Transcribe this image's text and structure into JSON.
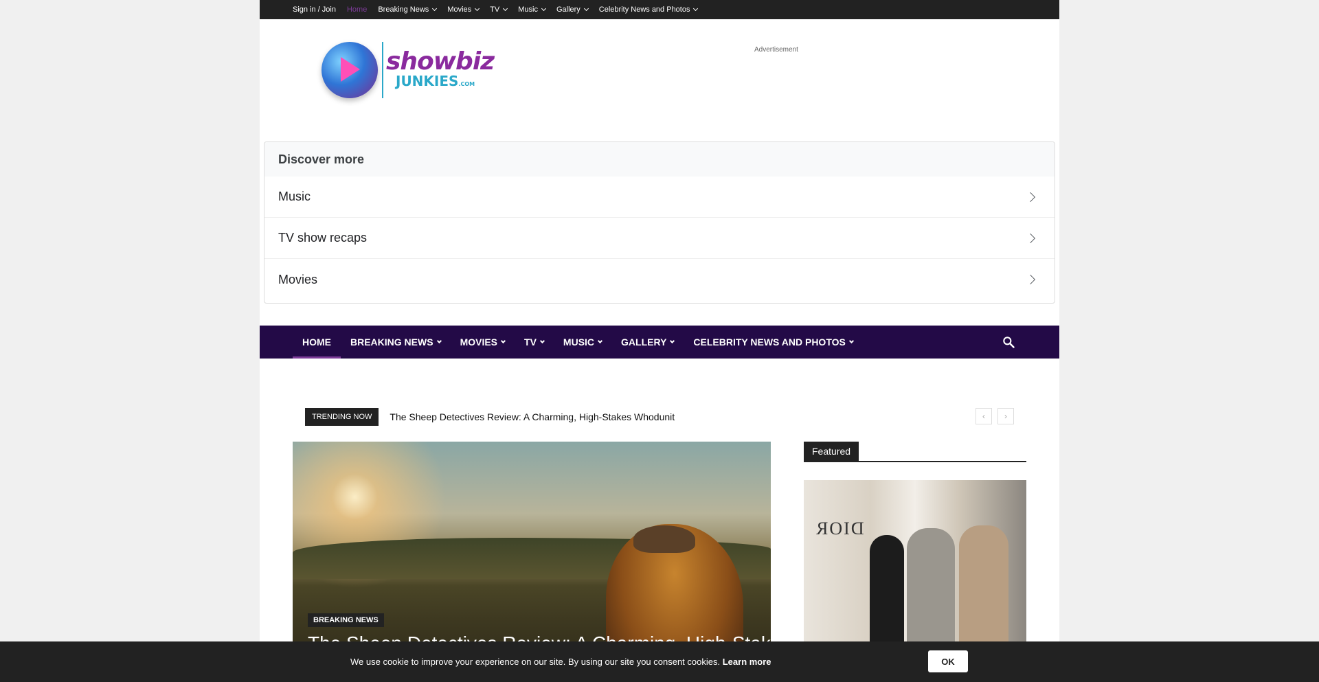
{
  "topbar": {
    "items": [
      {
        "label": "Sign in / Join",
        "dropdown": false
      },
      {
        "label": "Home",
        "dropdown": false,
        "active": true
      },
      {
        "label": "Breaking News",
        "dropdown": true
      },
      {
        "label": "Movies",
        "dropdown": true
      },
      {
        "label": "TV",
        "dropdown": true
      },
      {
        "label": "Music",
        "dropdown": true
      },
      {
        "label": "Gallery",
        "dropdown": true
      },
      {
        "label": "Celebrity News and Photos",
        "dropdown": true
      }
    ]
  },
  "header": {
    "logo": {
      "line1": "showbiz",
      "line2": "JUNKIES",
      "tld": ".COM"
    },
    "ad_label": "Advertisement"
  },
  "discover": {
    "title": "Discover more",
    "items": [
      "Music",
      "TV show recaps",
      "Movies"
    ]
  },
  "mainnav": {
    "items": [
      "HOME",
      "BREAKING NEWS",
      "MOVIES",
      "TV",
      "MUSIC",
      "GALLERY",
      "CELEBRITY NEWS AND PHOTOS"
    ],
    "active_index": 0
  },
  "trending": {
    "label": "TRENDING NOW",
    "title": "The Sheep Detectives Review: A Charming, High-Stakes Whodunit"
  },
  "hero": {
    "category": "BREAKING NEWS",
    "title": "The Sheep Detectives Review: A Charming, High-Stakes Whodunit"
  },
  "featured": {
    "label": "Featured",
    "image_text": "DIOR"
  },
  "cookie": {
    "text": "We use cookie to improve your experience on our site. By using our site you consent cookies.",
    "link": "Learn more",
    "ok_label": "OK"
  },
  "colors": {
    "nav_bg": "#230a47",
    "accent": "#7d3c98",
    "topbar_bg": "#222222"
  }
}
